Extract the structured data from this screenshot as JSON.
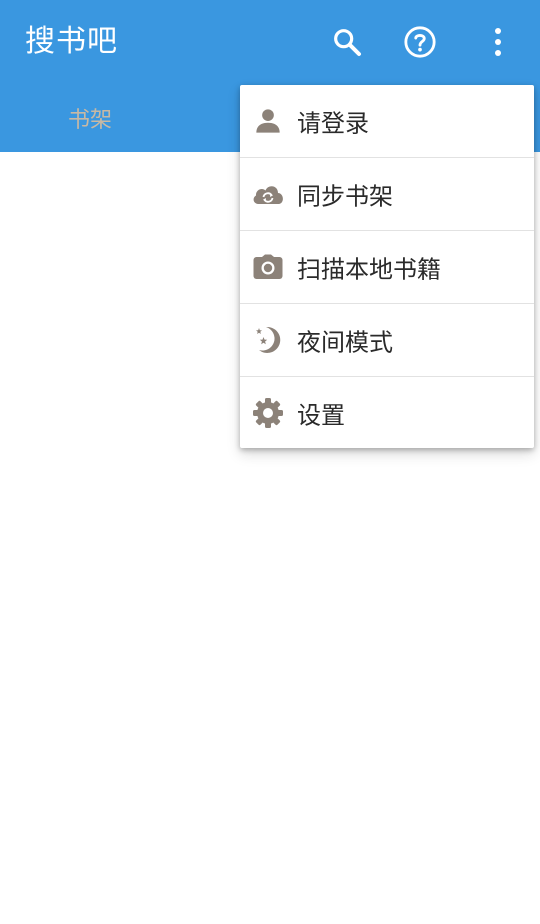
{
  "app": {
    "title": "搜书吧"
  },
  "toolbar": {
    "search_icon": "search-icon",
    "help_icon": "help-circle-icon",
    "more_icon": "more-vertical-icon"
  },
  "tabs": [
    {
      "label": "书架"
    }
  ],
  "menu": {
    "items": [
      {
        "label": "请登录",
        "icon": "user-icon"
      },
      {
        "label": "同步书架",
        "icon": "cloud-sync-icon"
      },
      {
        "label": "扫描本地书籍",
        "icon": "camera-icon"
      },
      {
        "label": "夜间模式",
        "icon": "moon-stars-icon"
      },
      {
        "label": "设置",
        "icon": "gear-icon"
      }
    ]
  },
  "colors": {
    "primary": "#3a97e0",
    "tab_text": "#c8b9a4",
    "menu_icon": "#8c8279",
    "menu_text": "#2a2a2a"
  }
}
